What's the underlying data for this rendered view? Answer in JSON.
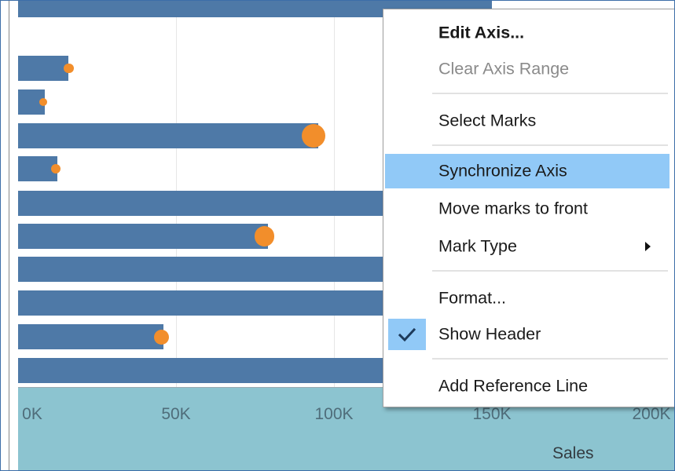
{
  "chart_data": {
    "type": "bar",
    "orientation": "horizontal",
    "xlabel": "Sales",
    "x_ticks": [
      "0K",
      "50K",
      "100K",
      "150K",
      "200K"
    ],
    "xlim": [
      0,
      200000
    ],
    "bar_color": "#4e79a7",
    "circle_color": "#f28e2b",
    "series": [
      {
        "mark": "bar",
        "values": [
          150000,
          16000,
          8500,
          95000,
          12500,
          150000,
          79000,
          150000,
          150000,
          46000,
          150000
        ]
      },
      {
        "mark": "circle",
        "values": [
          null,
          16000,
          8000,
          93500,
          12000,
          null,
          78000,
          null,
          null,
          45500,
          null
        ],
        "sizes": [
          null,
          2,
          1,
          10,
          2,
          null,
          8,
          null,
          null,
          5,
          null
        ]
      }
    ]
  },
  "context_menu": {
    "items": [
      {
        "label": "Edit Axis...",
        "bold": true
      },
      {
        "label": "Clear Axis Range",
        "disabled": true
      },
      {
        "label": "Select Marks"
      },
      {
        "label": "Synchronize Axis",
        "highlighted": true
      },
      {
        "label": "Move marks to front"
      },
      {
        "label": "Mark Type",
        "submenu": true
      },
      {
        "label": "Format..."
      },
      {
        "label": "Show Header",
        "checked": true
      },
      {
        "label": "Add Reference Line"
      }
    ]
  },
  "icons": {
    "check": "checkmark-icon",
    "submenu": "submenu-arrow-icon"
  }
}
